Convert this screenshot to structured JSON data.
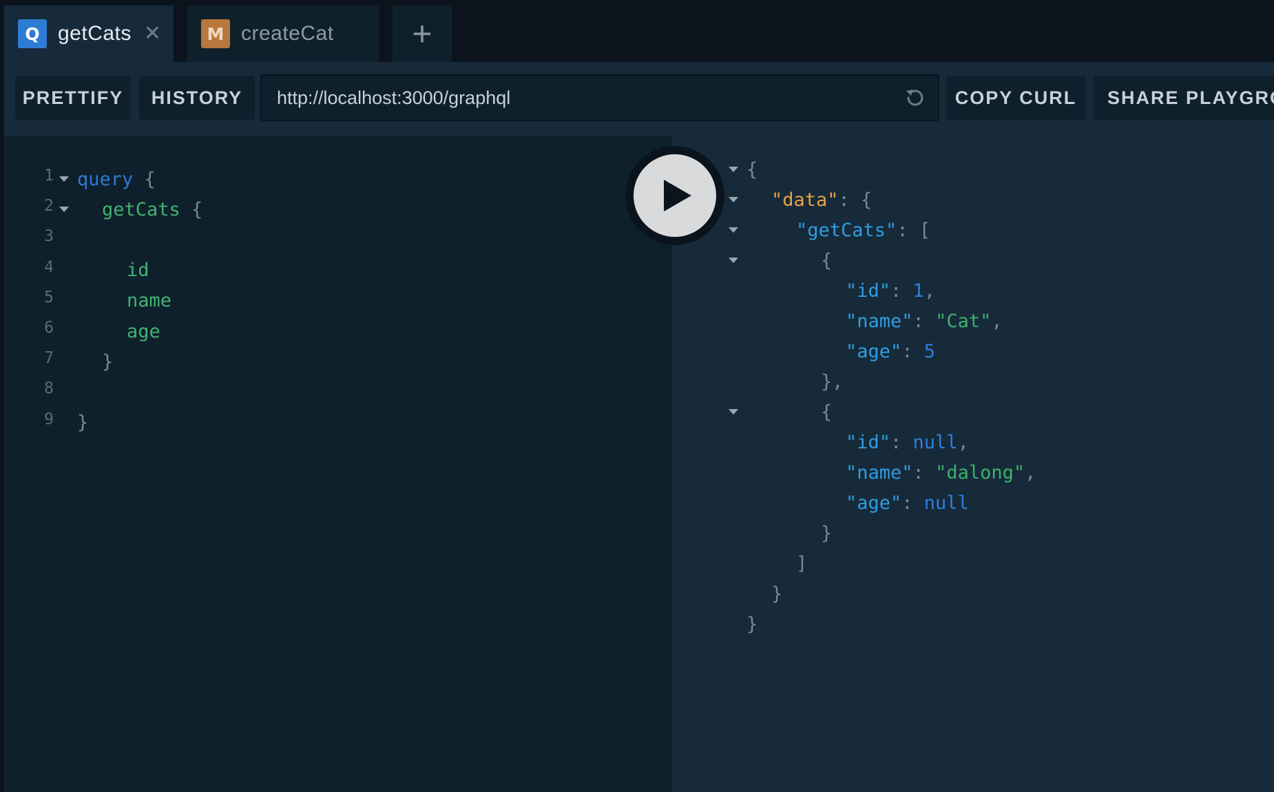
{
  "tabs": [
    {
      "badge": "Q",
      "label": "getCats",
      "close_glyph": "✕",
      "active": true
    },
    {
      "badge": "M",
      "label": "createCat",
      "active": false
    }
  ],
  "tab_add_glyph": "+",
  "toolbar": {
    "prettify_label": "PRETTIFY",
    "history_label": "HISTORY",
    "url_value": "http://localhost:3000/graphql",
    "copy_curl_label": "COPY CURL",
    "share_label": "SHARE PLAYGROUND"
  },
  "icons": {
    "reload": "reload-icon",
    "play": "play-icon",
    "close": "close-icon",
    "plus": "plus-icon",
    "fold": "chevron-down-icon"
  },
  "query_lines": [
    {
      "n": "1",
      "tokens": [
        {
          "t": "query",
          "c": "kw"
        },
        {
          "t": " {",
          "c": "punc"
        }
      ],
      "fold": true,
      "indent": 0
    },
    {
      "n": "2",
      "tokens": [
        {
          "t": "getCats",
          "c": "field"
        },
        {
          "t": " {",
          "c": "punc"
        }
      ],
      "fold": true,
      "indent": 1
    },
    {
      "n": "3",
      "tokens": [],
      "fold": false,
      "indent": 0
    },
    {
      "n": "4",
      "tokens": [
        {
          "t": "id",
          "c": "field"
        }
      ],
      "fold": false,
      "indent": 2
    },
    {
      "n": "5",
      "tokens": [
        {
          "t": "name",
          "c": "field"
        }
      ],
      "fold": false,
      "indent": 2
    },
    {
      "n": "6",
      "tokens": [
        {
          "t": "age",
          "c": "field"
        }
      ],
      "fold": false,
      "indent": 2
    },
    {
      "n": "7",
      "tokens": [
        {
          "t": "}",
          "c": "punc"
        }
      ],
      "fold": false,
      "indent": 1
    },
    {
      "n": "8",
      "tokens": [],
      "fold": false,
      "indent": 0
    },
    {
      "n": "9",
      "tokens": [
        {
          "t": "}",
          "c": "punc"
        }
      ],
      "fold": false,
      "indent": 0
    }
  ],
  "result_lines": [
    {
      "tokens": [
        {
          "t": "{",
          "c": "punc"
        }
      ],
      "fold": true,
      "indent": 0
    },
    {
      "tokens": [
        {
          "t": "\"data\"",
          "c": "str"
        },
        {
          "t": ": {",
          "c": "punc"
        }
      ],
      "fold": true,
      "indent": 1
    },
    {
      "tokens": [
        {
          "t": "\"getCats\"",
          "c": "key"
        },
        {
          "t": ": [",
          "c": "punc"
        }
      ],
      "fold": true,
      "indent": 2
    },
    {
      "tokens": [
        {
          "t": "{",
          "c": "punc"
        }
      ],
      "fold": true,
      "indent": 3
    },
    {
      "tokens": [
        {
          "t": "\"id\"",
          "c": "key"
        },
        {
          "t": ": ",
          "c": "punc"
        },
        {
          "t": "1",
          "c": "num"
        },
        {
          "t": ",",
          "c": "punc"
        }
      ],
      "fold": false,
      "indent": 4
    },
    {
      "tokens": [
        {
          "t": "\"name\"",
          "c": "key"
        },
        {
          "t": ": ",
          "c": "punc"
        },
        {
          "t": "\"Cat\"",
          "c": "sval"
        },
        {
          "t": ",",
          "c": "punc"
        }
      ],
      "fold": false,
      "indent": 4
    },
    {
      "tokens": [
        {
          "t": "\"age\"",
          "c": "key"
        },
        {
          "t": ": ",
          "c": "punc"
        },
        {
          "t": "5",
          "c": "num"
        }
      ],
      "fold": false,
      "indent": 4
    },
    {
      "tokens": [
        {
          "t": "},",
          "c": "punc"
        }
      ],
      "fold": false,
      "indent": 3
    },
    {
      "tokens": [
        {
          "t": "{",
          "c": "punc"
        }
      ],
      "fold": true,
      "indent": 3
    },
    {
      "tokens": [
        {
          "t": "\"id\"",
          "c": "key"
        },
        {
          "t": ": ",
          "c": "punc"
        },
        {
          "t": "null",
          "c": "num"
        },
        {
          "t": ",",
          "c": "punc"
        }
      ],
      "fold": false,
      "indent": 4
    },
    {
      "tokens": [
        {
          "t": "\"name\"",
          "c": "key"
        },
        {
          "t": ": ",
          "c": "punc"
        },
        {
          "t": "\"dalong\"",
          "c": "sval"
        },
        {
          "t": ",",
          "c": "punc"
        }
      ],
      "fold": false,
      "indent": 4
    },
    {
      "tokens": [
        {
          "t": "\"age\"",
          "c": "key"
        },
        {
          "t": ": ",
          "c": "punc"
        },
        {
          "t": "null",
          "c": "num"
        }
      ],
      "fold": false,
      "indent": 4
    },
    {
      "tokens": [
        {
          "t": "}",
          "c": "punc"
        }
      ],
      "fold": false,
      "indent": 3
    },
    {
      "tokens": [
        {
          "t": "]",
          "c": "punc"
        }
      ],
      "fold": false,
      "indent": 2
    },
    {
      "tokens": [
        {
          "t": "}",
          "c": "punc"
        }
      ],
      "fold": false,
      "indent": 1
    },
    {
      "tokens": [
        {
          "t": "}",
          "c": "punc"
        }
      ],
      "fold": false,
      "indent": 0
    }
  ],
  "colors": {
    "background": "#0b141c",
    "panel": "#172a3a",
    "editor": "#0f202d",
    "query_badge": "#2e7bd6",
    "mutation_badge": "#b7773d",
    "keyword": "#2e7bd6",
    "field": "#42b26f",
    "json_data_key": "#e8a244",
    "json_key": "#2f9de0",
    "json_string": "#3bb36b"
  }
}
